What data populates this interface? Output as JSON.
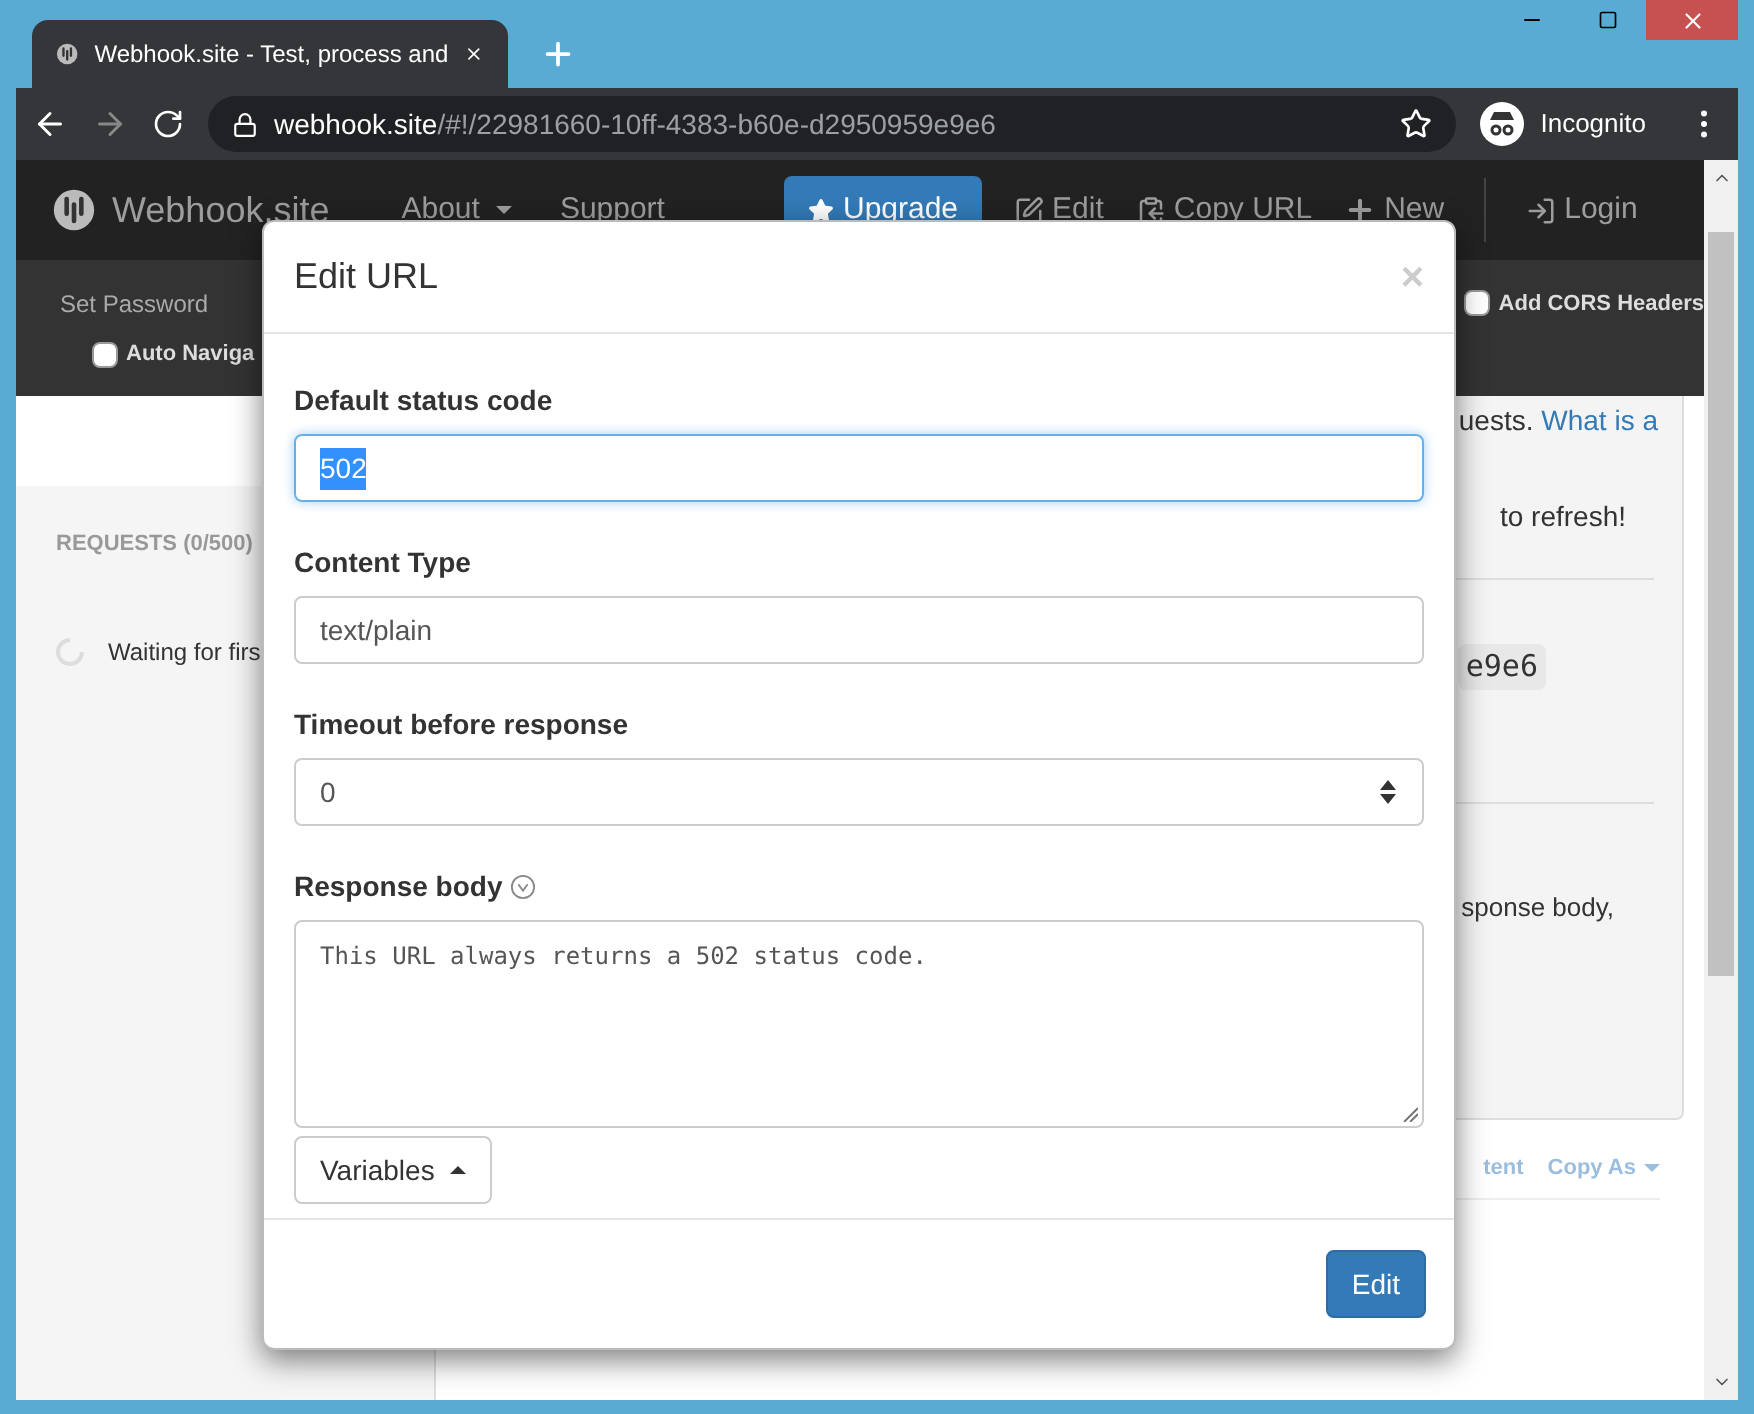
{
  "browser": {
    "tab_title": "Webhook.site - Test, process and",
    "url_host": "webhook.site",
    "url_path": "/#!/22981660-10ff-4383-b60e-d2950959e9e6",
    "profile": "Incognito"
  },
  "navbar": {
    "brand": "Webhook.site",
    "items": [
      {
        "label": "About",
        "kind": "dropdown"
      },
      {
        "label": "Support",
        "kind": "link"
      },
      {
        "label": "Upgrade",
        "kind": "primary"
      },
      {
        "label": "Edit",
        "kind": "edit"
      },
      {
        "label": "Copy URL",
        "kind": "copy"
      },
      {
        "label": "New",
        "kind": "new"
      },
      {
        "label": "Login",
        "kind": "login"
      }
    ]
  },
  "subbar": {
    "set_password": "Set Password",
    "cors": {
      "label": "Add CORS Headers",
      "checked": false
    },
    "auto_navigate": {
      "label": "Auto Naviga",
      "checked": false
    }
  },
  "sidebar": {
    "header": "REQUESTS (0/500)",
    "waiting": "Waiting for firs"
  },
  "main": {
    "intro_text": "uests.",
    "intro_link": "What is a",
    "refresh": "to refresh!",
    "code": "e9e6",
    "response_text": "sponse body,",
    "tab_fragment": "tent",
    "copy_as": "Copy As"
  },
  "modal": {
    "title": "Edit URL",
    "close": "×",
    "fields": [
      {
        "label": "Default status code",
        "kind": "text",
        "value": "502",
        "focused": true
      },
      {
        "label": "Content Type",
        "kind": "text",
        "value": "text/plain",
        "focused": false
      },
      {
        "label": "Timeout before response",
        "kind": "number",
        "value": "0",
        "focused": false
      },
      {
        "label": "Response body",
        "kind": "textarea",
        "value": "This URL always returns a 502 status code.",
        "focused": false
      }
    ],
    "variables": "Variables",
    "submit": "Edit"
  }
}
